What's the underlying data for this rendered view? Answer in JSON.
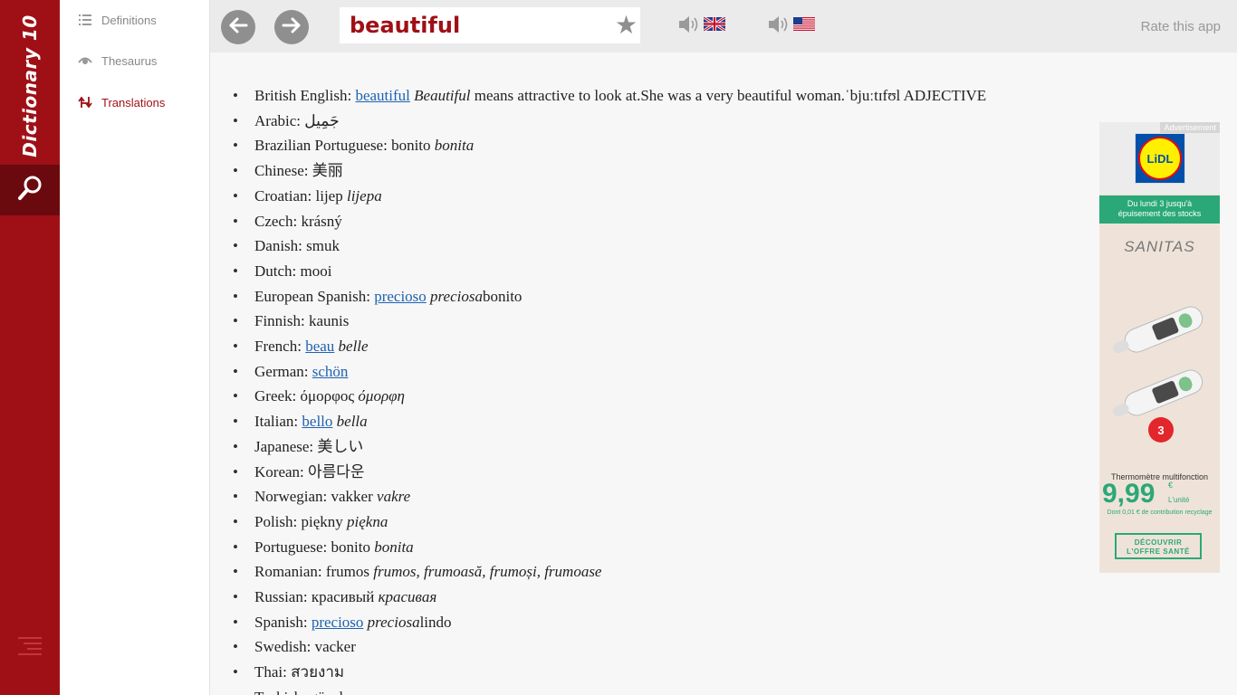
{
  "app": {
    "title": "Dictionary 10"
  },
  "nav": {
    "items": [
      {
        "label": "Definitions",
        "icon": "list-icon"
      },
      {
        "label": "Thesaurus",
        "icon": "eye-icon"
      },
      {
        "label": "Translations",
        "icon": "translate-icon",
        "active": true
      }
    ]
  },
  "toolbar": {
    "search_value": "beautiful",
    "back_icon": "arrow-left-icon",
    "forward_icon": "arrow-right-icon",
    "favorite_icon": "star-icon",
    "star_glyph": "★",
    "uk_audio_icon": "speaker-uk-icon",
    "us_audio_icon": "speaker-us-icon",
    "rate_label": "Rate this app"
  },
  "translations": [
    {
      "lang": "British English: ",
      "link": "beautiful",
      "italic": "Beautiful",
      "after": " means attractive to look at.She was a very beautiful woman.ˈbjuːtɪfʊl ADJECTIVE"
    },
    {
      "lang": "Arabic: ",
      "text": "جَمِيل"
    },
    {
      "lang": "Brazilian Portuguese: ",
      "text": "bonito ",
      "italic": "bonita"
    },
    {
      "lang": "Chinese: ",
      "text": "美丽"
    },
    {
      "lang": "Croatian: ",
      "text": "lijep ",
      "italic": "lijepa"
    },
    {
      "lang": "Czech: ",
      "text": "krásný"
    },
    {
      "lang": "Danish: ",
      "text": "smuk"
    },
    {
      "lang": "Dutch: ",
      "text": "mooi"
    },
    {
      "lang": "European Spanish: ",
      "link": "precioso",
      "italic": "preciosa",
      "after": "bonito"
    },
    {
      "lang": "Finnish: ",
      "text": "kaunis"
    },
    {
      "lang": "French: ",
      "link": "beau",
      "italic": "belle"
    },
    {
      "lang": "German: ",
      "link": "schön"
    },
    {
      "lang": "Greek: ",
      "text": "όμορφος ",
      "italic": "όμορφη"
    },
    {
      "lang": "Italian: ",
      "link": "bello",
      "italic": "bella"
    },
    {
      "lang": "Japanese: ",
      "text": "美しい"
    },
    {
      "lang": "Korean: ",
      "text": "아름다운"
    },
    {
      "lang": "Norwegian: ",
      "text": "vakker ",
      "italic": "vakre"
    },
    {
      "lang": "Polish: ",
      "text": "piękny ",
      "italic": "piękna"
    },
    {
      "lang": "Portuguese: ",
      "text": "bonito ",
      "italic": "bonita"
    },
    {
      "lang": "Romanian: ",
      "text": "frumos ",
      "italic": "frumos, frumoasă, frumoși, frumoase"
    },
    {
      "lang": "Russian: ",
      "text": "красивый ",
      "italic": "красивая"
    },
    {
      "lang": "Spanish: ",
      "link": "precioso",
      "italic": "preciosa",
      "after": "lindo"
    },
    {
      "lang": "Swedish: ",
      "text": "vacker"
    },
    {
      "lang": "Thai: ",
      "text": "สวยงาม"
    },
    {
      "lang": "Turkish: ",
      "text": "güzel"
    }
  ],
  "ad": {
    "label": "Advertisement",
    "brand": "LiDL",
    "band_line1": "Du lundi 3 jusqu'à",
    "band_line2": "épuisement des stocks",
    "product_brand": "SANITAS",
    "product_name": "Thermomètre multifonction",
    "price": "9,99",
    "currency": "€",
    "unit": "L'unité",
    "contribution": "Dont 0,01 € de contribution recyclage",
    "cta_line1": "DÉCOUVRIR",
    "cta_line2": "L'OFFRE SANTÉ"
  },
  "colors": {
    "brand": "#9f1016",
    "brand_dark": "#6b0a0e",
    "link": "#1e62b0",
    "ad_green": "#2aa878"
  }
}
